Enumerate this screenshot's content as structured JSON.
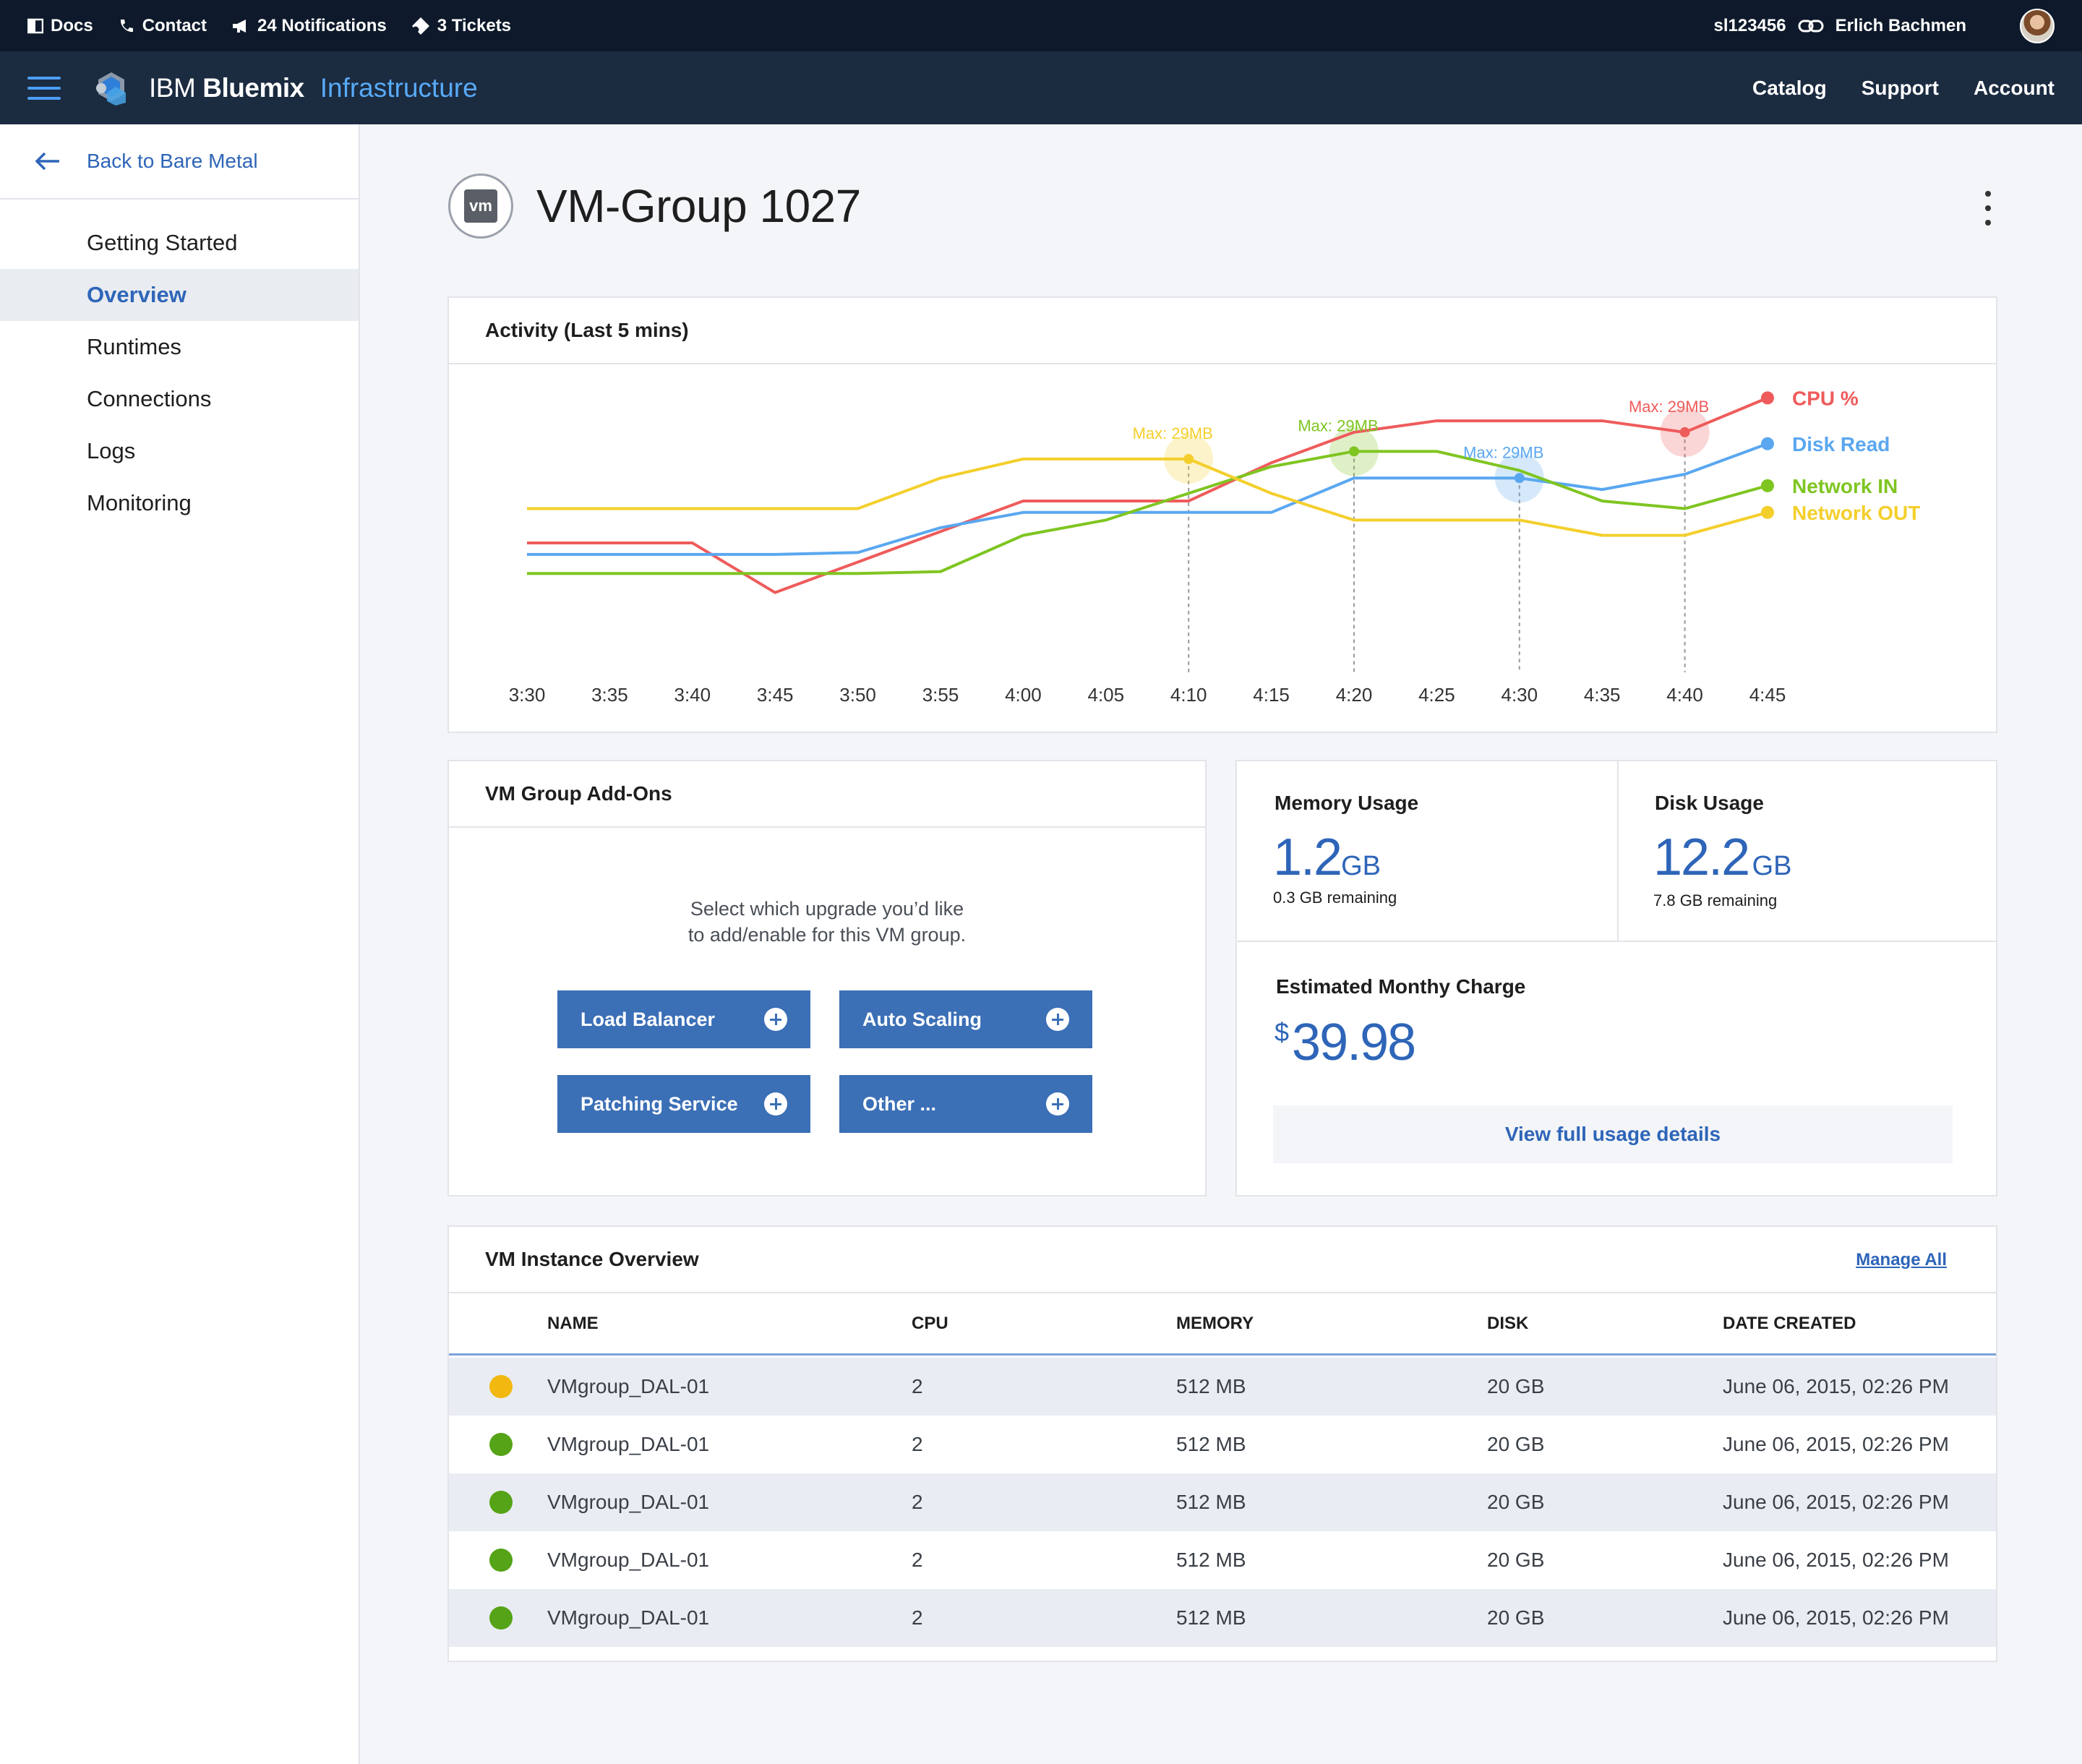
{
  "topbar": {
    "docs": "Docs",
    "contact": "Contact",
    "notifications": "24 Notifications",
    "tickets": "3 Tickets",
    "account_id": "sl123456",
    "user_name": "Erlich Bachmen"
  },
  "brandbar": {
    "brand_ibm": "IBM",
    "brand_bluemix": "Bluemix",
    "brand_infra": "Infrastructure",
    "nav": [
      "Catalog",
      "Support",
      "Account"
    ]
  },
  "sidebar": {
    "back_label": "Back to Bare Metal",
    "items": [
      {
        "label": "Getting Started",
        "active": false
      },
      {
        "label": "Overview",
        "active": true
      },
      {
        "label": "Runtimes",
        "active": false
      },
      {
        "label": "Connections",
        "active": false
      },
      {
        "label": "Logs",
        "active": false
      },
      {
        "label": "Monitoring",
        "active": false
      }
    ]
  },
  "page": {
    "badge": "vm",
    "title": "VM-Group 1027"
  },
  "activity": {
    "title": "Activity (Last 5 mins)"
  },
  "chart_data": {
    "type": "line",
    "title": "Activity (Last 5 mins)",
    "x": [
      "3:30",
      "3:35",
      "3:40",
      "3:45",
      "3:50",
      "3:55",
      "4:00",
      "4:05",
      "4:10",
      "4:15",
      "4:20",
      "4:25",
      "4:30",
      "4:35",
      "4:40",
      "4:45"
    ],
    "series": [
      {
        "name": "CPU %",
        "color": "#ef5b5b",
        "points": [
          [
            "3:30",
            3.2
          ],
          [
            "3:40",
            3.2
          ],
          [
            "3:45",
            1.9
          ],
          [
            "3:50",
            2.7
          ],
          [
            "3:55",
            3.5
          ],
          [
            "4:00",
            4.3
          ],
          [
            "4:10",
            4.3
          ],
          [
            "4:15",
            5.3
          ],
          [
            "4:20",
            6.1
          ],
          [
            "4:25",
            6.4
          ],
          [
            "4:30",
            6.4
          ],
          [
            "4:35",
            6.4
          ],
          [
            "4:40",
            6.1
          ],
          [
            "4:45",
            7.0
          ]
        ]
      },
      {
        "name": "Disk Read",
        "color": "#5aa7f0",
        "points": [
          [
            "3:30",
            2.9
          ],
          [
            "3:45",
            2.9
          ],
          [
            "3:50",
            2.95
          ],
          [
            "3:55",
            3.6
          ],
          [
            "4:00",
            4.0
          ],
          [
            "4:05",
            4.0
          ],
          [
            "4:10",
            4.0
          ],
          [
            "4:15",
            4.0
          ],
          [
            "4:20",
            4.9
          ],
          [
            "4:25",
            4.9
          ],
          [
            "4:30",
            4.9
          ],
          [
            "4:35",
            4.6
          ],
          [
            "4:40",
            5.0
          ],
          [
            "4:45",
            5.8
          ]
        ]
      },
      {
        "name": "Network IN",
        "color": "#7fc521",
        "points": [
          [
            "3:30",
            2.4
          ],
          [
            "3:45",
            2.4
          ],
          [
            "3:50",
            2.4
          ],
          [
            "3:55",
            2.45
          ],
          [
            "4:00",
            3.4
          ],
          [
            "4:05",
            3.8
          ],
          [
            "4:10",
            4.5
          ],
          [
            "4:15",
            5.2
          ],
          [
            "4:20",
            5.6
          ],
          [
            "4:25",
            5.6
          ],
          [
            "4:30",
            5.1
          ],
          [
            "4:35",
            4.3
          ],
          [
            "4:40",
            4.1
          ],
          [
            "4:45",
            4.7
          ]
        ]
      },
      {
        "name": "Network OUT",
        "color": "#f4cf2c",
        "points": [
          [
            "3:30",
            4.1
          ],
          [
            "3:45",
            4.1
          ],
          [
            "3:50",
            4.1
          ],
          [
            "3:55",
            4.9
          ],
          [
            "4:00",
            5.4
          ],
          [
            "4:05",
            5.4
          ],
          [
            "4:10",
            5.4
          ],
          [
            "4:15",
            4.5
          ],
          [
            "4:20",
            3.8
          ],
          [
            "4:25",
            3.8
          ],
          [
            "4:30",
            3.8
          ],
          [
            "4:35",
            3.4
          ],
          [
            "4:40",
            3.4
          ],
          [
            "4:45",
            4.0
          ]
        ]
      }
    ],
    "annotations": [
      {
        "x": "4:10",
        "series": "Network OUT",
        "label": "Max: 29MB",
        "color": "#f4cf2c"
      },
      {
        "x": "4:20",
        "series": "Network IN",
        "label": "Max: 29MB",
        "color": "#7fc521"
      },
      {
        "x": "4:30",
        "series": "Disk Read",
        "label": "Max: 29MB",
        "color": "#5aa7f0"
      },
      {
        "x": "4:40",
        "series": "CPU %",
        "label": "Max: 29MB",
        "color": "#ef5b5b"
      }
    ],
    "legend_position": "right",
    "grid": false
  },
  "addons": {
    "title": "VM Group Add-Ons",
    "description_line1": "Select which upgrade you’d like",
    "description_line2": "to add/enable for this VM group.",
    "buttons": [
      "Load Balancer",
      "Auto Scaling",
      "Patching Service",
      "Other ..."
    ]
  },
  "usage": {
    "memory_label": "Memory Usage",
    "memory_value": "1.2",
    "memory_unit": "GB",
    "memory_sub": "0.3 GB remaining",
    "disk_label": "Disk Usage",
    "disk_value": "12.2",
    "disk_unit": "GB",
    "disk_sub": "7.8 GB remaining",
    "charge_label": "Estimated Monthy Charge",
    "charge_currency": "$",
    "charge_value": "39.98",
    "details_button": "View full usage details"
  },
  "instances": {
    "title": "VM Instance Overview",
    "manage_all": "Manage All",
    "columns": [
      "NAME",
      "CPU",
      "MEMORY",
      "DISK",
      "DATE CREATED"
    ],
    "rows": [
      {
        "status_color": "#f2b80f",
        "name": "VMgroup_DAL-01",
        "cpu": "2",
        "memory": "512 MB",
        "disk": "20 GB",
        "date": "June 06, 2015, 02:26 PM"
      },
      {
        "status_color": "#55a316",
        "name": "VMgroup_DAL-01",
        "cpu": "2",
        "memory": "512 MB",
        "disk": "20 GB",
        "date": "June 06, 2015, 02:26 PM"
      },
      {
        "status_color": "#55a316",
        "name": "VMgroup_DAL-01",
        "cpu": "2",
        "memory": "512 MB",
        "disk": "20 GB",
        "date": "June 06, 2015, 02:26 PM"
      },
      {
        "status_color": "#55a316",
        "name": "VMgroup_DAL-01",
        "cpu": "2",
        "memory": "512 MB",
        "disk": "20 GB",
        "date": "June 06, 2015, 02:26 PM"
      },
      {
        "status_color": "#55a316",
        "name": "VMgroup_DAL-01",
        "cpu": "2",
        "memory": "512 MB",
        "disk": "20 GB",
        "date": "June 06, 2015, 02:26 PM"
      }
    ]
  }
}
